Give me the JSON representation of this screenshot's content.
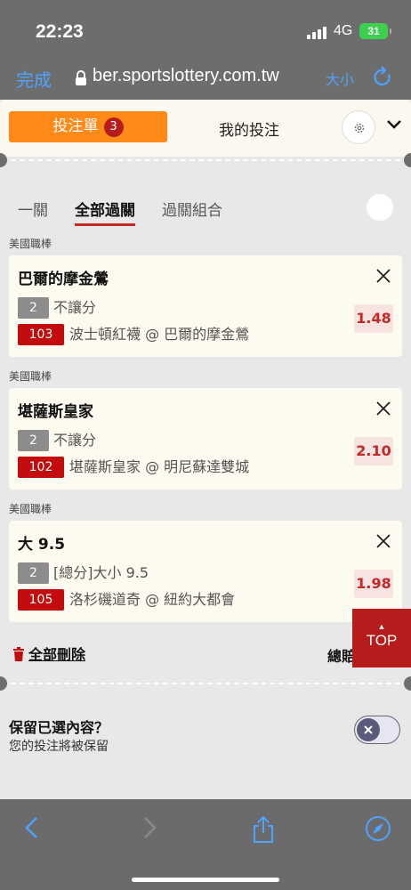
{
  "status_bar": {
    "time": "22:23",
    "network": "4G",
    "battery": "31"
  },
  "browser": {
    "done_label": "完成",
    "url": "ber.sportslottery.com.tw",
    "text_size_label": "大小"
  },
  "header": {
    "bet_slip_tab": "投注單",
    "bet_slip_count": "3",
    "my_bets_tab": "我的投注"
  },
  "sub_tabs": [
    "一關",
    "全部過關",
    "過關組合"
  ],
  "bets": [
    {
      "league": "美國職棒",
      "title": "巴爾的摩金鶯",
      "type_code": "2",
      "bet_type": "不讓分",
      "game_code": "103",
      "match": "波士頓紅襪 @ 巴爾的摩金鶯",
      "odds": "1.48"
    },
    {
      "league": "美國職棒",
      "title": "堪薩斯皇家",
      "type_code": "2",
      "bet_type": "不讓分",
      "game_code": "102",
      "match": "堪薩斯皇家 @ 明尼蘇達雙城",
      "odds": "2.10"
    },
    {
      "league": "美國職棒",
      "title": "大 9.5",
      "type_code": "2",
      "bet_type": "[總分]大小 9.5",
      "game_code": "105",
      "match": "洛杉磯道奇 @ 紐約大都會",
      "odds": "1.98"
    }
  ],
  "footer": {
    "clear_all": "全部刪除",
    "total_label": "總賠",
    "top_button": "TOP"
  },
  "keep": {
    "title": "保留已選內容？",
    "description": "您的投注將被保留"
  },
  "colors": {
    "accent_orange": "#ff8a18",
    "brand_red": "#c10d0d",
    "odds_red": "#c62828",
    "ios_blue": "#4da3ff"
  }
}
